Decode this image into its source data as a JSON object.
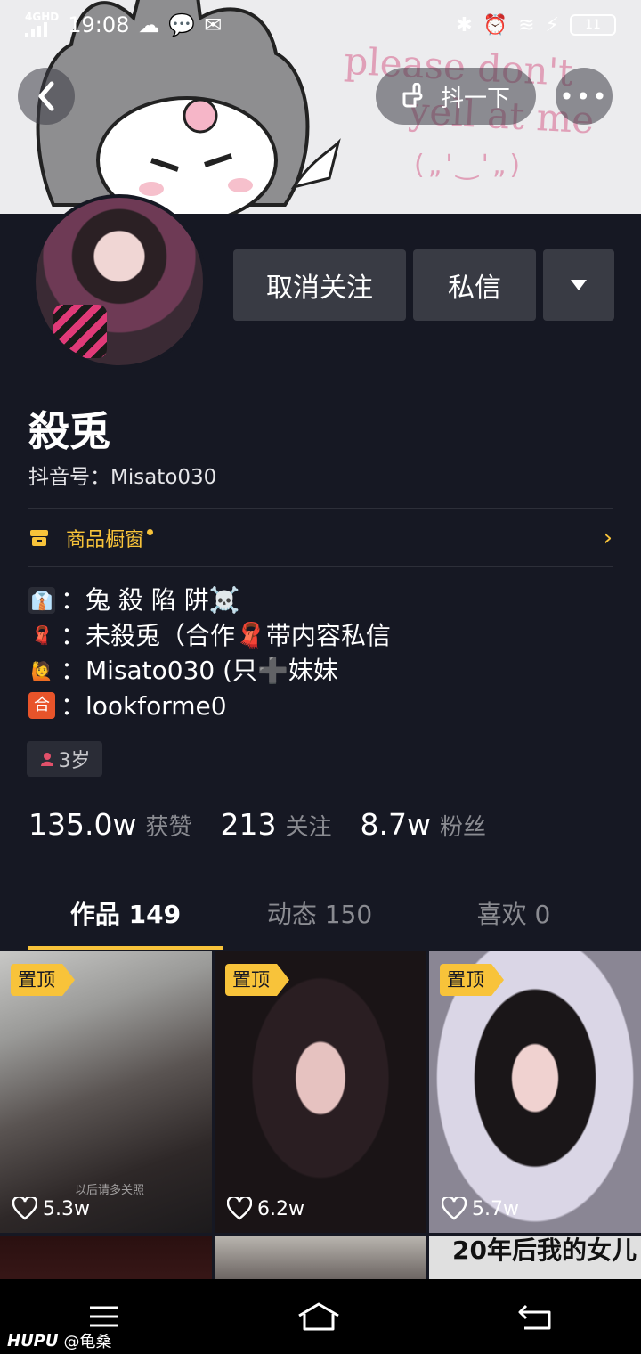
{
  "status_bar": {
    "network": "4G",
    "network_sub": "HD",
    "time": "19:08",
    "battery": "11"
  },
  "header": {
    "shake_label": "抖一下",
    "banner_text_1": "please don't",
    "banner_text_2": "yell at me",
    "banner_face": "(„'‿'„)"
  },
  "profile": {
    "unfollow_label": "取消关注",
    "message_label": "私信",
    "name": "殺兎",
    "douyin_id": "抖音号：Misato030",
    "shop_label": "商品橱窗",
    "bio": [
      {
        "icon": "tie-icon",
        "text": "：兔 殺 陷 阱☠️"
      },
      {
        "icon": "scarf-icon",
        "text": "：未殺兎（合作🧣带内容私信"
      },
      {
        "icon": "person-icon",
        "text": "：Misato030 (只➕妹妹"
      },
      {
        "icon": "he-icon",
        "text": "：lookforme0"
      }
    ],
    "age": "3岁"
  },
  "stats": {
    "likes_value": "135.0w",
    "likes_label": "获赞",
    "following_value": "213",
    "following_label": "关注",
    "followers_value": "8.7w",
    "followers_label": "粉丝"
  },
  "tabs": [
    {
      "label": "作品 149"
    },
    {
      "label": "动态 150"
    },
    {
      "label": "喜欢 0"
    }
  ],
  "videos": [
    {
      "pinned": "置顶",
      "likes": "5.3w",
      "caption": "以后请多关照"
    },
    {
      "pinned": "置顶",
      "likes": "6.2w"
    },
    {
      "pinned": "置顶",
      "likes": "5.7w"
    },
    {
      "overlay_text": "20年后我的女儿"
    }
  ],
  "watermark": {
    "brand": "HUPU",
    "user": "@龟桑"
  },
  "colors": {
    "background": "#161823",
    "accent": "#f8c33a",
    "button": "#393b44"
  }
}
